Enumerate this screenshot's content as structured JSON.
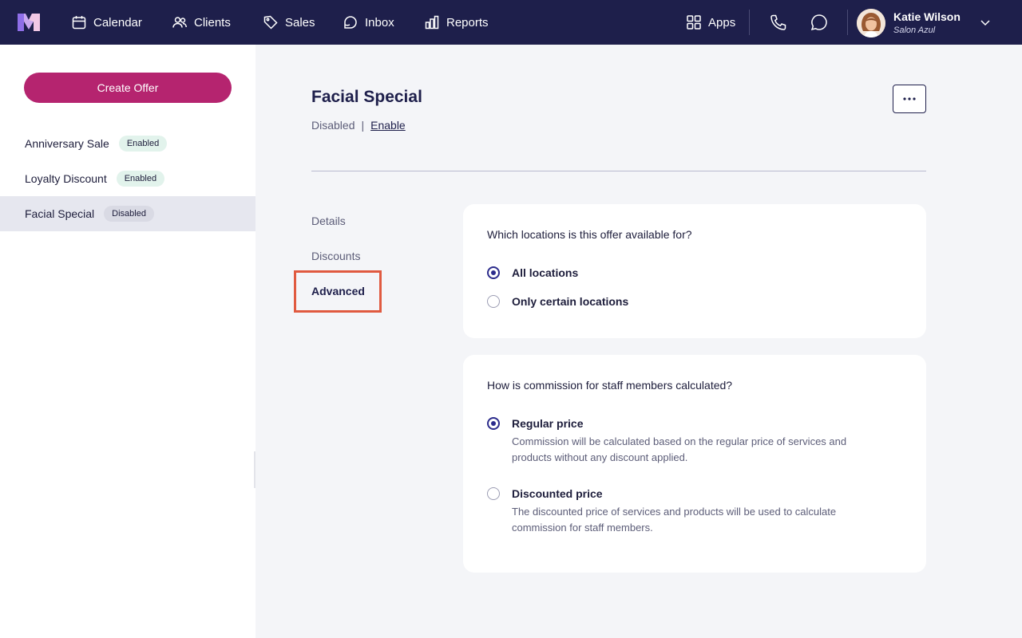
{
  "nav": {
    "items": [
      {
        "label": "Calendar",
        "icon": "calendar-icon"
      },
      {
        "label": "Clients",
        "icon": "users-icon"
      },
      {
        "label": "Sales",
        "icon": "tag-icon"
      },
      {
        "label": "Inbox",
        "icon": "chat-icon"
      },
      {
        "label": "Reports",
        "icon": "bar-chart-icon"
      }
    ],
    "apps_label": "Apps",
    "user_name": "Katie Wilson",
    "user_org": "Salon Azul"
  },
  "sidebar": {
    "create_label": "Create Offer",
    "offers": [
      {
        "name": "Anniversary Sale",
        "status": "Enabled"
      },
      {
        "name": "Loyalty Discount",
        "status": "Enabled"
      },
      {
        "name": "Facial Special",
        "status": "Disabled"
      }
    ]
  },
  "main": {
    "title": "Facial Special",
    "status": "Disabled",
    "separator": "|",
    "enable_label": "Enable",
    "tabs": [
      {
        "label": "Details"
      },
      {
        "label": "Discounts"
      },
      {
        "label": "Advanced"
      }
    ],
    "locations": {
      "question": "Which locations is this offer available for?",
      "options": [
        {
          "label": "All locations",
          "selected": true
        },
        {
          "label": "Only certain locations",
          "selected": false
        }
      ]
    },
    "commission": {
      "question": "How is commission for staff members calculated?",
      "options": [
        {
          "label": "Regular price",
          "description": "Commission will be calculated based on the regular price of services and products without any discount applied.",
          "selected": true
        },
        {
          "label": "Discounted price",
          "description": "The discounted price of services and products will be used to calculate commission for staff members.",
          "selected": false
        }
      ]
    }
  },
  "colors": {
    "nav_bg": "#1e1f4b",
    "primary_button": "#b5246f",
    "radio_selected": "#2c2c8c",
    "highlight_box": "#e05a40"
  }
}
